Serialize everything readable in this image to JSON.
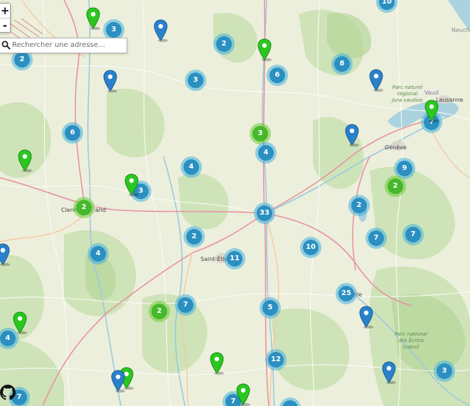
{
  "controls": {
    "zoom_in": "+",
    "zoom_out": "-"
  },
  "search": {
    "placeholder": "Rechercher une adresse…",
    "value": "",
    "icon": "search-icon"
  },
  "colors": {
    "cluster_blue": "#2b8fc1",
    "cluster_green": "#45b82b",
    "marker_blue": "#2a81cb",
    "marker_green": "#2ac81f",
    "lake": "#aad3df"
  },
  "map_labels": {
    "clermont_left": "Clerm",
    "clermont_right": "and",
    "saint_etienne": "Saint-Étien",
    "grenoble": "ble",
    "geneve": "Genève",
    "lausanne": "Lausanne",
    "vaud": "Vaud",
    "neuchatel": "Neuchâ",
    "jura_line1": "Parc naturel",
    "jura_line2": "régional",
    "jura_line3": "Jura vaudois",
    "ecrins_line1": "Parc national",
    "ecrins_line2": "des Écrins",
    "ecrins_line3": "(cœur)"
  },
  "clusters": [
    {
      "count": "10",
      "color": "blue"
    },
    {
      "count": "3",
      "color": "blue"
    },
    {
      "count": "2",
      "color": "blue"
    },
    {
      "count": "2",
      "color": "blue"
    },
    {
      "count": "3",
      "color": "blue"
    },
    {
      "count": "6",
      "color": "blue"
    },
    {
      "count": "8",
      "color": "blue"
    },
    {
      "count": "6",
      "color": "blue"
    },
    {
      "count": "3",
      "color": "green"
    },
    {
      "count": "4",
      "color": "blue"
    },
    {
      "count": "7",
      "color": "blue"
    },
    {
      "count": "4",
      "color": "blue"
    },
    {
      "count": "3",
      "color": "blue"
    },
    {
      "count": "9",
      "color": "blue"
    },
    {
      "count": "2",
      "color": "green"
    },
    {
      "count": "2",
      "color": "green"
    },
    {
      "count": "33",
      "color": "blue"
    },
    {
      "count": "2",
      "color": "blue"
    },
    {
      "count": "2",
      "color": "blue"
    },
    {
      "count": "7",
      "color": "blue"
    },
    {
      "count": "7",
      "color": "blue"
    },
    {
      "count": "4",
      "color": "blue"
    },
    {
      "count": "10",
      "color": "blue"
    },
    {
      "count": "11",
      "color": "blue"
    },
    {
      "count": "25",
      "color": "blue"
    },
    {
      "count": "7",
      "color": "blue"
    },
    {
      "count": "5",
      "color": "blue"
    },
    {
      "count": "2",
      "color": "green"
    },
    {
      "count": "4",
      "color": "blue"
    },
    {
      "count": "12",
      "color": "blue"
    },
    {
      "count": "3",
      "color": "blue"
    },
    {
      "count": "7",
      "color": "blue"
    },
    {
      "count": "7",
      "color": "blue"
    }
  ],
  "markers": [
    {
      "color": "green"
    },
    {
      "color": "blue"
    },
    {
      "color": "green"
    },
    {
      "color": "blue"
    },
    {
      "color": "blue"
    },
    {
      "color": "green"
    },
    {
      "color": "blue"
    },
    {
      "color": "green"
    },
    {
      "color": "green"
    },
    {
      "color": "blue"
    },
    {
      "color": "green"
    },
    {
      "color": "blue"
    },
    {
      "color": "blue"
    },
    {
      "color": "green"
    },
    {
      "color": "blue"
    },
    {
      "color": "green"
    },
    {
      "color": "green"
    }
  ]
}
